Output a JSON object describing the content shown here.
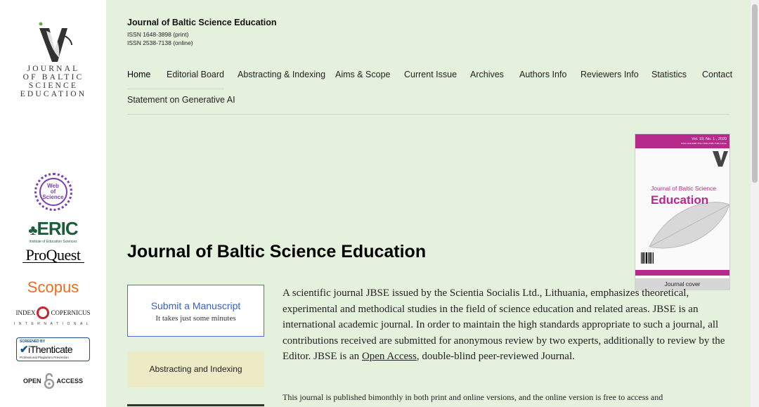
{
  "sidebar": {
    "journal_logo_text": [
      "JOURNAL",
      "OF BALTIC",
      "SCIENCE",
      "EDUCATION"
    ],
    "indexes": {
      "wos_line1": "Web",
      "wos_line2": "of",
      "wos_line3": "Science",
      "eric": "ERIC",
      "eric_sub": "Institute of Education Sciences",
      "proquest": "ProQuest",
      "scopus": "Scopus",
      "copernicus_left": "INDEX",
      "copernicus_right": "COPERNICUS",
      "copernicus_sub": "INTERNATIONAL",
      "ithenticate_top": "SCREENED BY",
      "ithenticate": "iThenticate",
      "ithenticate_sub": "Professional Plagiarism Prevention",
      "open_access_left": "OPEN",
      "open_access_right": "ACCESS"
    }
  },
  "header": {
    "journal_title": "Journal of Baltic Science Education",
    "issn_print": "ISSN 1648-3898 (print)",
    "issn_online": "ISSN 2538-7138 (online)"
  },
  "nav": {
    "items": [
      "Home",
      "Editorial Board",
      "Abstracting & Indexing",
      "Aims & Scope",
      "Current Issue",
      "Archives",
      "Authors Info",
      "Reviewers Info",
      "Statistics",
      "Contact",
      "Statement on Generative AI"
    ],
    "active": "Home"
  },
  "cover": {
    "issue": "Vol. 19, No. 1 , 2020",
    "issn_line": "ISSN 1648-3898 /Print/ ISSN 2538-7138 /Online/",
    "title_small": "Journal of Baltic Science",
    "title_big": "Education",
    "caption": "Journal cover"
  },
  "main": {
    "title": "Journal of Baltic Science Education",
    "submit_title": "Submit a Manuscript",
    "submit_sub": "It takes just some minutes",
    "abstracting_button": "Abstracting and Indexing",
    "paragraph1_a": "A scientific journal JBSE issued by the Scientia Socialis Ltd., Lithuania, emphasizes theoretical, experimental and methodical studies in the field of science education and related areas. JBSE is an international academic journal. In order to maintain the high standards appropriate to such a journal, all contributions received are submitted for anonymous review by two experts, additionally to review by the Editor. JBSE is an ",
    "paragraph1_link": "Open Access",
    "paragraph1_b": ", double-blind peer-reviewed Journal.",
    "paragraph2": "This journal is published bimonthly in both print and online versions, and the online version is free to access and"
  },
  "colors": {
    "background": "#e4f1dd",
    "accent_link": "#3460d4",
    "cover_magenta": "#b52a8a",
    "abstracting_bg": "#ecebc5"
  }
}
